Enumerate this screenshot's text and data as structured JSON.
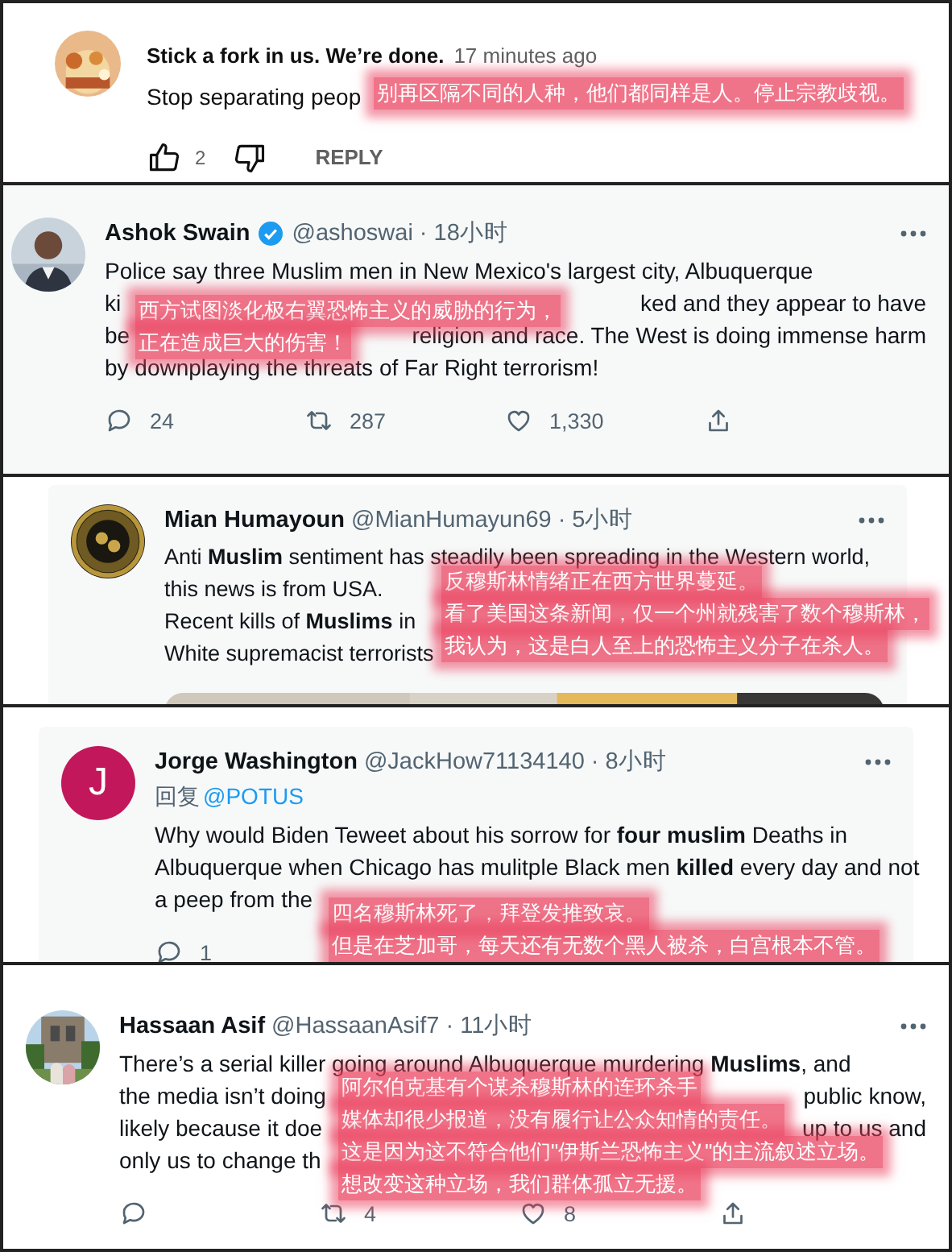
{
  "comment": {
    "author": "Stick a fork in us. We’re done.",
    "time": "17 minutes ago",
    "text": "Stop separating peop",
    "likes": "2",
    "reply": "REPLY",
    "annotation": [
      "别再区隔不同的人种，他们都同样是人。停止宗教歧视。"
    ]
  },
  "tweets": [
    {
      "avatar": {
        "kind": "picture"
      },
      "name": "Ashok Swain",
      "verified": true,
      "handle": "@ashoswai",
      "time": "· 18小时",
      "lines": [
        [
          "Police say three  Muslim men in New Mexico's largest city, Albuquerque"
        ],
        [
          "ki",
          "ked and they appear to have"
        ],
        [
          "be",
          "religion and race. The West is doing immense harm"
        ],
        [
          "by downplaying the threats of Far Right terrorism!"
        ]
      ],
      "actions": [
        {
          "kind": "reply",
          "count": "24"
        },
        {
          "kind": "retweet",
          "count": "287"
        },
        {
          "kind": "like",
          "count": "1,330"
        },
        {
          "kind": "share"
        }
      ],
      "annotation": [
        "西方试图淡化极右翼恐怖主义的威胁的行为，",
        "正在造成巨大的伤害！"
      ]
    },
    {
      "avatar": {
        "kind": "picture"
      },
      "name": "Mian Humayoun",
      "verified": false,
      "handle": "@MianHumayun69",
      "time": "· 5小时",
      "lines": [
        [
          "Anti **Muslim** sentiment has steadily been spreading in the Western world,"
        ],
        [
          "this news is from USA."
        ],
        [
          "Recent kills of **Muslims** in"
        ],
        [
          "White supremacist terrorists"
        ]
      ],
      "media": {
        "kind": "picture"
      },
      "annotation": [
        "反穆斯林情绪正在西方世界蔓延。",
        "看了美国这条新闻，仅一个州就残害了数个穆斯林，",
        "我认为，这是白人至上的恐怖主义分子在杀人。"
      ]
    },
    {
      "avatar": {
        "kind": "letter",
        "letter": "J"
      },
      "name": "Jorge Washington",
      "verified": false,
      "handle": "@JackHow71134140",
      "time": "· 8小时",
      "reply_to": {
        "label": "回复",
        "target": "@POTUS"
      },
      "lines": [
        [
          "Why would Biden Teweet about his sorrow for **four muslim** Deaths in"
        ],
        [
          "Albuquerque when Chicago has mulitple Black men **killed** every day and not"
        ],
        [
          "a peep from the"
        ]
      ],
      "actions": [
        {
          "kind": "reply",
          "count": "1"
        }
      ],
      "annotation": [
        "四名穆斯林死了，拜登发推致哀。",
        "但是在芝加哥，每天还有无数个黑人被杀，白宫根本不管。"
      ]
    },
    {
      "avatar": {
        "kind": "picture"
      },
      "name": "Hassaan Asif",
      "verified": false,
      "handle": "@HassaanAsif7",
      "time": "· 11小时",
      "lines": [
        [
          "There’s a serial killer going around Albuquerque murdering **Muslims**, and"
        ],
        [
          "the media isn’t doing",
          "public know,"
        ],
        [
          "likely because it doe",
          "up to us and"
        ],
        [
          "only us to change th"
        ]
      ],
      "actions": [
        {
          "kind": "reply"
        },
        {
          "kind": "retweet",
          "count": "4"
        },
        {
          "kind": "like",
          "count": "8"
        },
        {
          "kind": "share"
        }
      ],
      "annotation": [
        "阿尔伯克基有个谋杀穆斯林的连环杀手",
        "媒体却很少报道，没有履行让公众知情的责任。",
        "这是因为这不符合他们\"伊斯兰恐怖主义\"的主流叙述立场。",
        "想改变这种立场，我们群体孤立无援。"
      ]
    }
  ]
}
